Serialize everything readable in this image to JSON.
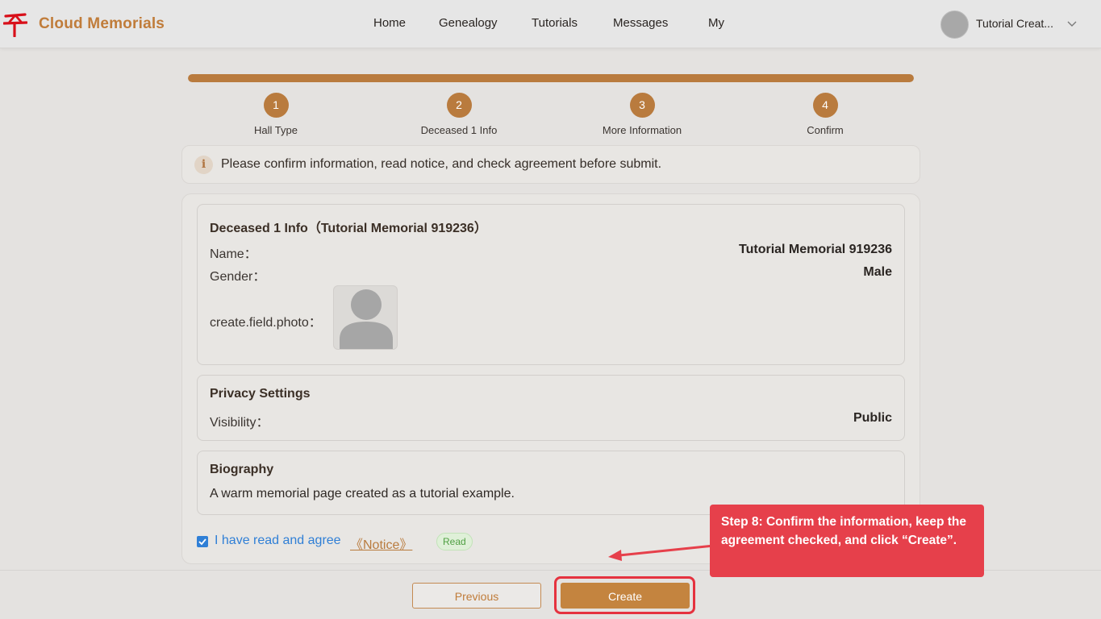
{
  "header": {
    "brand": "Cloud Memorials",
    "nav": [
      "Home",
      "Genealogy",
      "Tutorials",
      "Messages",
      "My"
    ],
    "user_name": "Tutorial Creat..."
  },
  "progress": {
    "fraction": 1.0,
    "steps": [
      {
        "number": "1",
        "label": "Hall Type"
      },
      {
        "number": "2",
        "label": "Deceased 1 Info"
      },
      {
        "number": "3",
        "label": "More Information"
      },
      {
        "number": "4",
        "label": "Confirm"
      }
    ]
  },
  "info_bar": {
    "icon_text": "i",
    "message": "Please confirm information, read notice, and check agreement before submit."
  },
  "deceased": {
    "title": "Deceased 1 Info（Tutorial Memorial 919236）",
    "name_label": "Name：",
    "name_value": "Tutorial Memorial 919236",
    "gender_label": "Gender：",
    "gender_value": "Male",
    "photo_label": "create.field.photo："
  },
  "privacy": {
    "title": "Privacy Settings",
    "visibility_label": "Visibility：",
    "visibility_value": "Public"
  },
  "biography": {
    "title": "Biography",
    "text": "A warm memorial page created as a tutorial example."
  },
  "agreement": {
    "checked": true,
    "text": "I have read and agree",
    "link": "《Notice》",
    "badge": "Read"
  },
  "buttons": {
    "previous": "Previous",
    "create": "Create"
  },
  "annotation": {
    "text": "Step 8: Confirm the information, keep the agreement checked, and click “Create”."
  },
  "colors": {
    "accent": "#b97b3e",
    "link_blue": "#2f7fd6",
    "annotation_red": "#e6404b",
    "logo_red": "#d8101a"
  }
}
